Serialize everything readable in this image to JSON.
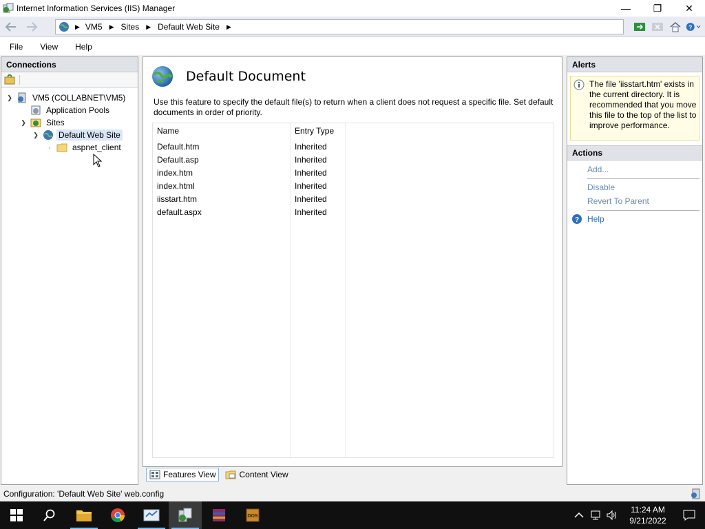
{
  "window": {
    "title": "Internet Information Services (IIS) Manager",
    "controls": {
      "minimize": "—",
      "restore": "❐",
      "close": "✕"
    }
  },
  "address": {
    "crumbs": [
      "VM5",
      "Sites",
      "Default Web Site"
    ]
  },
  "menu": {
    "items": [
      "File",
      "View",
      "Help"
    ]
  },
  "connections": {
    "header": "Connections",
    "tree": {
      "server": "VM5 (COLLABNET\\VM5)",
      "app_pools": "Application Pools",
      "sites": "Sites",
      "default_site": "Default Web Site",
      "aspnet_client": "aspnet_client"
    }
  },
  "feature": {
    "title": "Default Document",
    "description": "Use this feature to specify the default file(s) to return when a client does not request a specific file. Set default documents in order of priority.",
    "columns": {
      "name": "Name",
      "entry_type": "Entry Type"
    },
    "rows": [
      {
        "name": "Default.htm",
        "type": "Inherited"
      },
      {
        "name": "Default.asp",
        "type": "Inherited"
      },
      {
        "name": "index.htm",
        "type": "Inherited"
      },
      {
        "name": "index.html",
        "type": "Inherited"
      },
      {
        "name": "iisstart.htm",
        "type": "Inherited"
      },
      {
        "name": "default.aspx",
        "type": "Inherited"
      }
    ]
  },
  "views": {
    "features": "Features View",
    "content": "Content View"
  },
  "alerts": {
    "header": "Alerts",
    "message": "The file 'iisstart.htm' exists in the current directory. It is recommended that you move this file to the top of the list to improve performance."
  },
  "actions": {
    "header": "Actions",
    "add": "Add...",
    "disable": "Disable",
    "revert": "Revert To Parent",
    "help": "Help"
  },
  "status": {
    "text": "Configuration: 'Default Web Site' web.config"
  },
  "taskbar": {
    "time": "11:24 AM",
    "date": "9/21/2022"
  },
  "colors": {
    "accent": "#3b6fa9",
    "taskbar": "#101010",
    "alert_bg": "#fffde5"
  }
}
